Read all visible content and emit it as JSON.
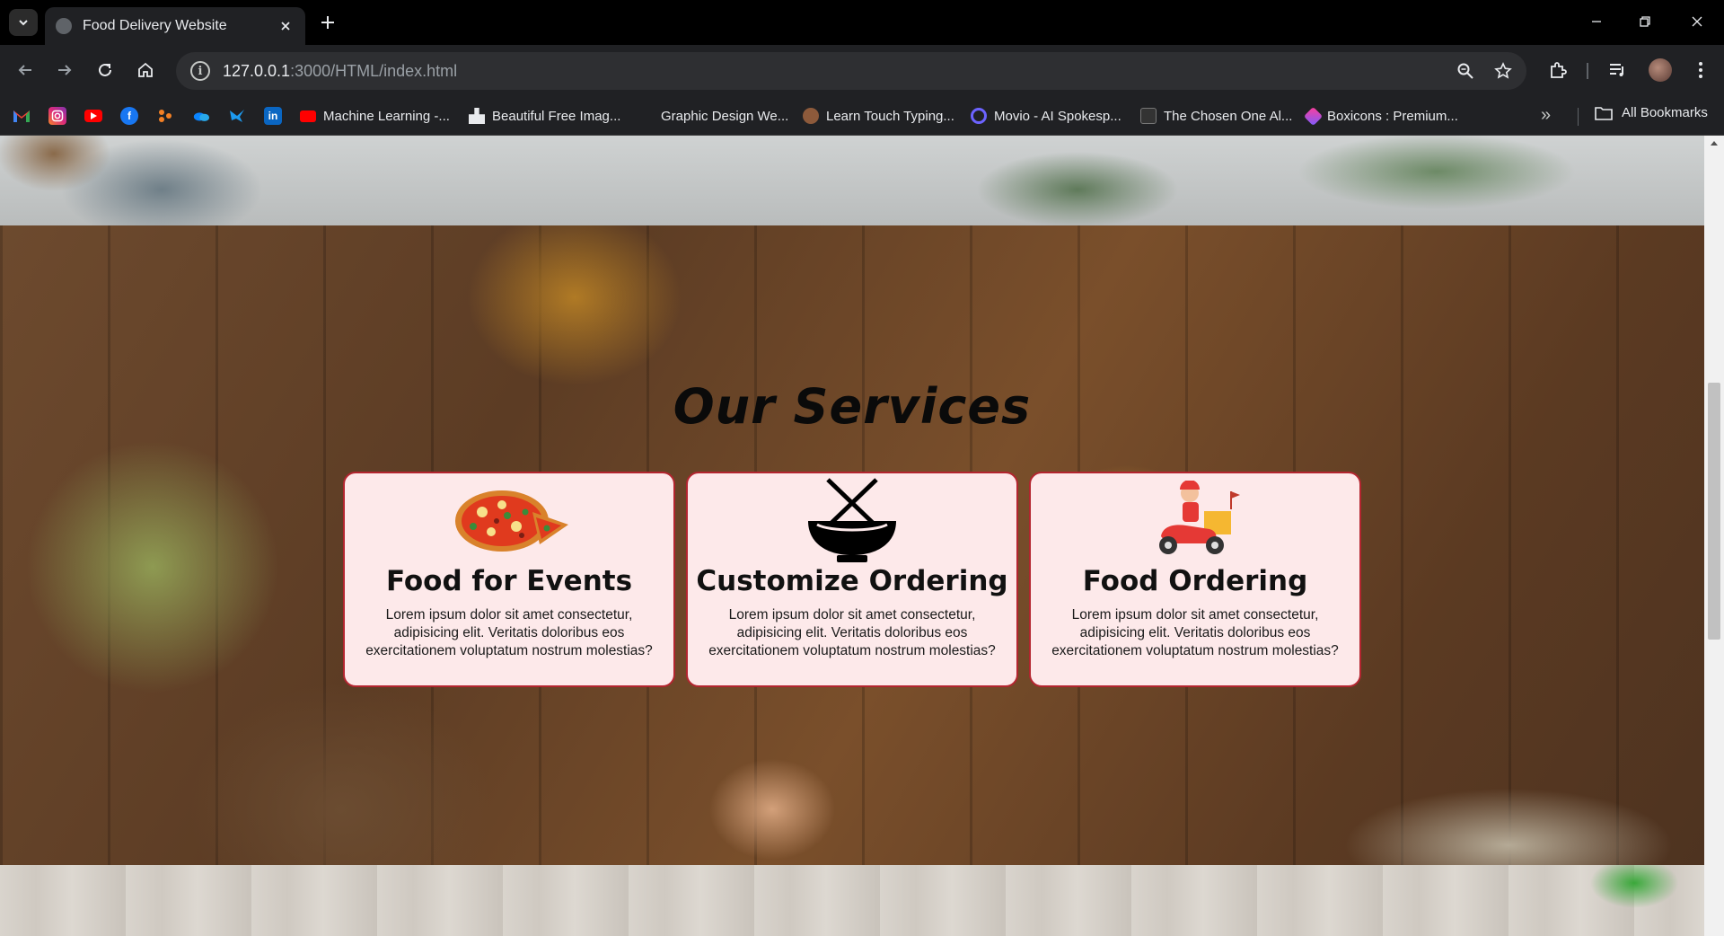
{
  "browser": {
    "tab_title": "Food Delivery Website",
    "url_host": "127.0.0.1",
    "url_path": ":3000/HTML/index.html"
  },
  "bookmarks": {
    "items": [
      {
        "label": "Machine Learning -...",
        "icon": "youtube-icon"
      },
      {
        "label": "Beautiful Free Imag...",
        "icon": "unsplash-icon"
      },
      {
        "label": "Graphic Design We...",
        "icon": "globe-icon"
      },
      {
        "label": "Learn Touch Typing...",
        "icon": "typing-icon"
      },
      {
        "label": "Movio - AI Spokesp...",
        "icon": "movio-icon"
      },
      {
        "label": "The Chosen One Al...",
        "icon": "chosen-icon"
      },
      {
        "label": "Boxicons : Premium...",
        "icon": "boxicons-icon"
      }
    ],
    "all_bookmarks": "All Bookmarks"
  },
  "services": {
    "title": "Our Services",
    "cards": [
      {
        "icon": "pizza-icon",
        "title": "Food for Events",
        "text": "Lorem ipsum dolor sit amet consectetur, adipisicing elit. Veritatis doloribus eos exercitationem voluptatum nostrum molestias?"
      },
      {
        "icon": "bowl-chopsticks-icon",
        "title": "Customize Ordering",
        "text": "Lorem ipsum dolor sit amet consectetur, adipisicing elit. Veritatis doloribus eos exercitationem voluptatum nostrum molestias?"
      },
      {
        "icon": "delivery-scooter-icon",
        "title": "Food Ordering",
        "text": "Lorem ipsum dolor sit amet consectetur, adipisicing elit. Veritatis doloribus eos exercitationem voluptatum nostrum molestias?"
      }
    ]
  },
  "colors": {
    "card_bg": "#fde9ea",
    "card_border": "#b3252f",
    "chrome_bg": "#202124"
  }
}
